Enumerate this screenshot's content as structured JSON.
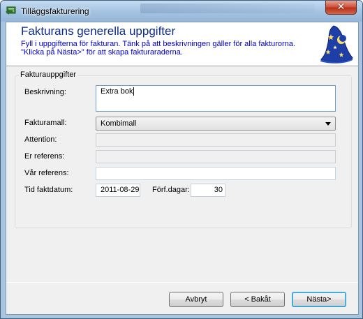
{
  "window": {
    "title": "Tilläggsfakturering",
    "close_glyph": "✕",
    "app_icon": "invoice-app-icon"
  },
  "header": {
    "title": "Fakturans generella uppgifter",
    "line1": "Fyll i uppgifterna för fakturan. Tänk på att beskrivningen gäller för alla fakturorna.",
    "line2": "\"Klicka på Nästa>\" för att skapa fakturaraderna.",
    "icon": "wizard-hat-icon"
  },
  "group": {
    "legend": "Fakturauppgifter",
    "fields": {
      "beskrivning_label": "Beskrivning:",
      "beskrivning_value": "Extra bok",
      "fakturamall_label": "Fakturamall:",
      "fakturamall_value": "Kombimall",
      "attention_label": "Attention:",
      "attention_value": "",
      "er_referens_label": "Er referens:",
      "er_referens_value": "",
      "var_referens_label": "Vår referens:",
      "var_referens_value": "",
      "tid_faktdatum_label": "Tid faktdatum:",
      "tid_faktdatum_value": "2011-08-29",
      "forf_dagar_label": "Förf.dagar:",
      "forf_dagar_value": "30"
    }
  },
  "buttons": {
    "cancel": "Avbryt",
    "back": "< Bakåt",
    "next": "Nästa>"
  },
  "colors": {
    "header_title": "#0b2a8a",
    "header_text": "#0000c8",
    "close_button": "#c7432a"
  }
}
